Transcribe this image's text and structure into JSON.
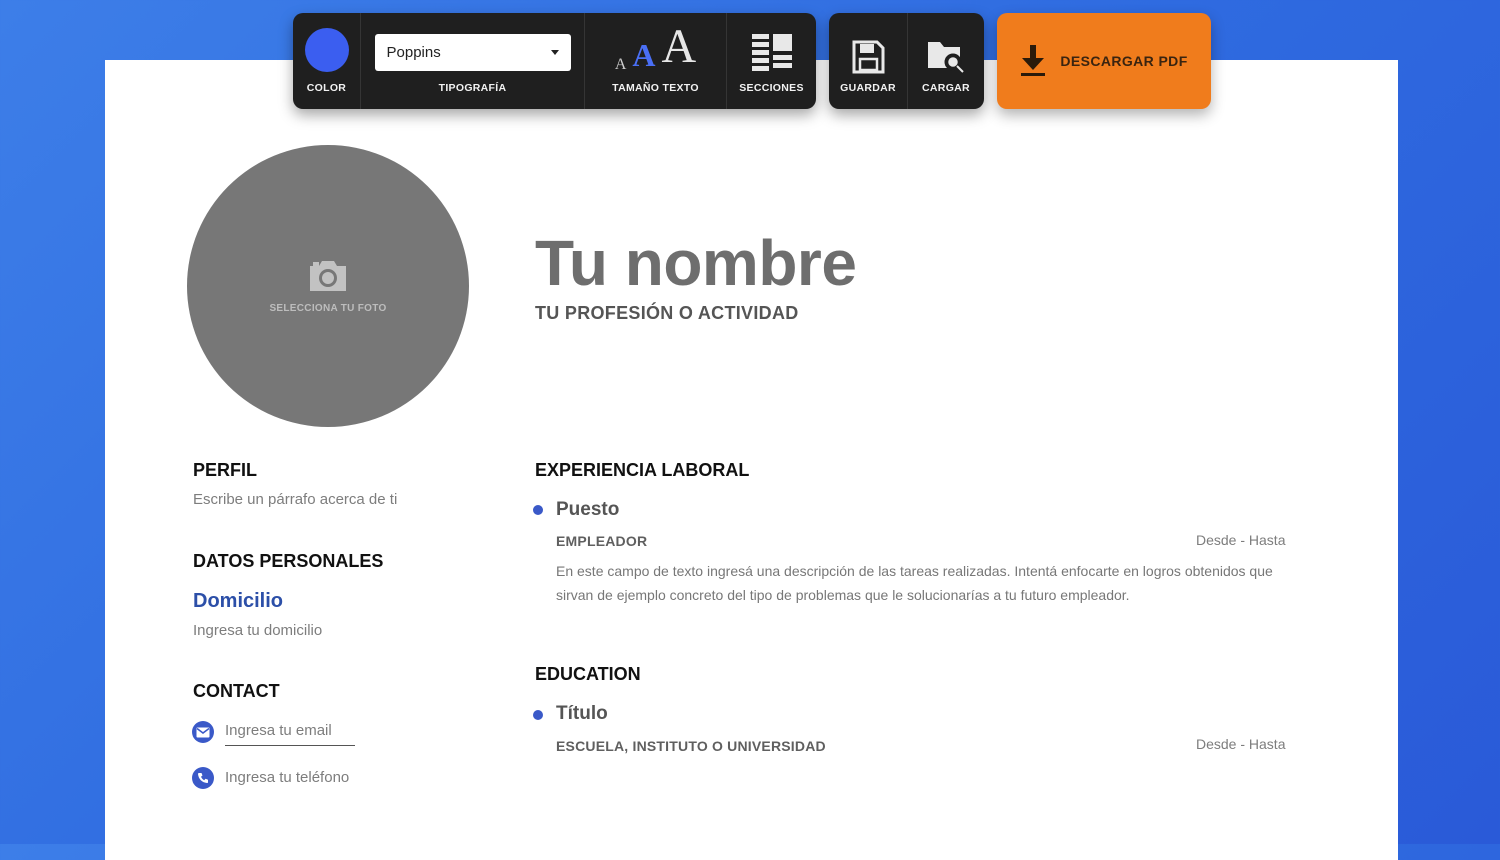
{
  "toolbar": {
    "color_label": "COLOR",
    "color_value": "#3b5ef0",
    "font_label": "TIPOGRAFÍA",
    "font_value": "Poppins",
    "size_label": "TAMAÑO TEXTO",
    "size_glyphs": [
      "A",
      "A",
      "A"
    ],
    "sections_label": "SECCIONES",
    "save_label": "GUARDAR",
    "load_label": "CARGAR",
    "download_label": "DESCARGAR PDF"
  },
  "colors": {
    "accent": "#3b5ef0",
    "download": "#f07c1c",
    "toolbar_bg": "#1f1f1f"
  },
  "photo": {
    "label": "SELECCIONA TU FOTO",
    "icon": "camera-icon"
  },
  "header": {
    "name": "Tu nombre",
    "profession": "TU PROFESIÓN O ACTIVIDAD"
  },
  "sidebar": {
    "profile_heading": "PERFIL",
    "profile_text": "Escribe un párrafo acerca de ti",
    "personal_heading": "DATOS PERSONALES",
    "address_label": "Domicilio",
    "address_placeholder": "Ingresa tu domicilio",
    "contact_heading": "CONTACT",
    "email_placeholder": "Ingresa tu email",
    "phone_placeholder": "Ingresa tu teléfono"
  },
  "experience": {
    "heading": "EXPERIENCIA LABORAL",
    "position": "Puesto",
    "employer": "EMPLEADOR",
    "dates": "Desde - Hasta",
    "description": "En este campo de texto ingresá una descripción de las tareas realizadas. Intentá enfocarte en logros obtenidos que sirvan de ejemplo concreto del tipo de problemas que le solucionarías a tu futuro empleador."
  },
  "education": {
    "heading": "EDUCATION",
    "title": "Título",
    "school": "ESCUELA, INSTITUTO O UNIVERSIDAD",
    "dates": "Desde - Hasta"
  }
}
